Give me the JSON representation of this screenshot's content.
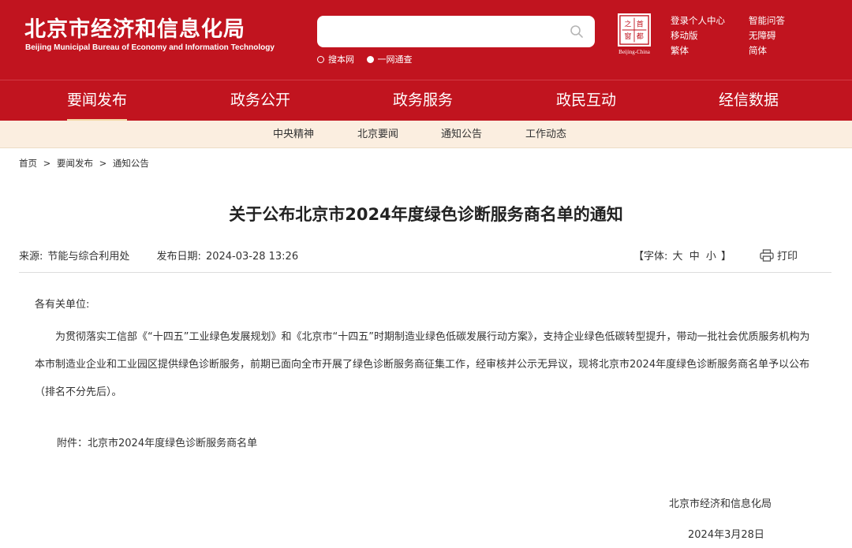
{
  "header": {
    "logo_cn": "北京市经济和信息化局",
    "logo_en": "Beijing Municipal Bureau of Economy and Information Technology",
    "search": {
      "placeholder": "",
      "options": [
        "搜本网",
        "一网通查"
      ],
      "selected": 1
    },
    "badge": {
      "chars": [
        "首",
        "都",
        "之",
        "窗"
      ],
      "caption": "Beijing-China"
    },
    "links_col1": [
      "登录个人中心",
      "移动版",
      "繁体"
    ],
    "links_col2": [
      "智能问答",
      "无障碍",
      "简体"
    ]
  },
  "mainnav": {
    "items": [
      "要闻发布",
      "政务公开",
      "政务服务",
      "政民互动",
      "经信数据"
    ],
    "active": 0
  },
  "subnav": {
    "items": [
      "中央精神",
      "北京要闻",
      "通知公告",
      "工作动态"
    ]
  },
  "breadcrumb": {
    "items": [
      "首页",
      "要闻发布",
      "通知公告"
    ],
    "sep": ">"
  },
  "article": {
    "title": "关于公布北京市2024年度绿色诊断服务商名单的通知",
    "source_label": "来源:",
    "source": "节能与综合利用处",
    "date_label": "发布日期:",
    "date": "2024-03-28 13:26",
    "font_label_open": "【字体:",
    "font_sizes": [
      "大",
      "中",
      "小"
    ],
    "font_label_close": "】",
    "print_label": "打印",
    "salutation": "各有关单位:",
    "paragraph": "为贯彻落实工信部《“十四五”工业绿色发展规划》和《北京市“十四五”时期制造业绿色低碳发展行动方案》，支持企业绿色低碳转型提升，带动一批社会优质服务机构为本市制造业企业和工业园区提供绿色诊断服务，前期已面向全市开展了绿色诊断服务商征集工作，经审核并公示无异议，现将北京市2024年度绿色诊断服务商名单予以公布（排名不分先后）。",
    "attachment": "附件：北京市2024年度绿色诊断服务商名单",
    "sign_org": "北京市经济和信息化局",
    "sign_date": "2024年3月28日"
  },
  "colors": {
    "brand_red": "#c1141f",
    "subnav_bg": "#fbeee0",
    "active_underline": "#f3d9a6"
  }
}
